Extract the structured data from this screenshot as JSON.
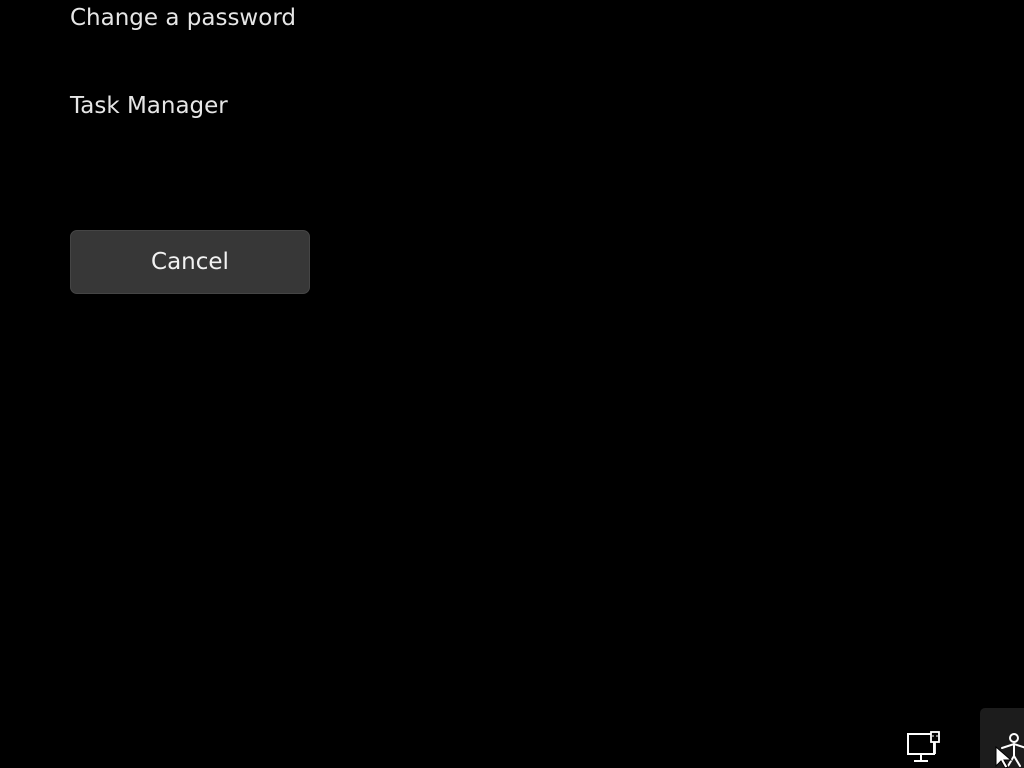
{
  "security_options": {
    "items": [
      {
        "label": "Change a password"
      },
      {
        "label": "Task Manager"
      }
    ],
    "cancel_label": "Cancel"
  },
  "system_tray": {
    "icons": [
      {
        "name": "network-icon"
      },
      {
        "name": "accessibility-icon"
      }
    ]
  },
  "colors": {
    "background": "#000000",
    "text": "#e6e6e6",
    "button_bg": "#373737"
  }
}
